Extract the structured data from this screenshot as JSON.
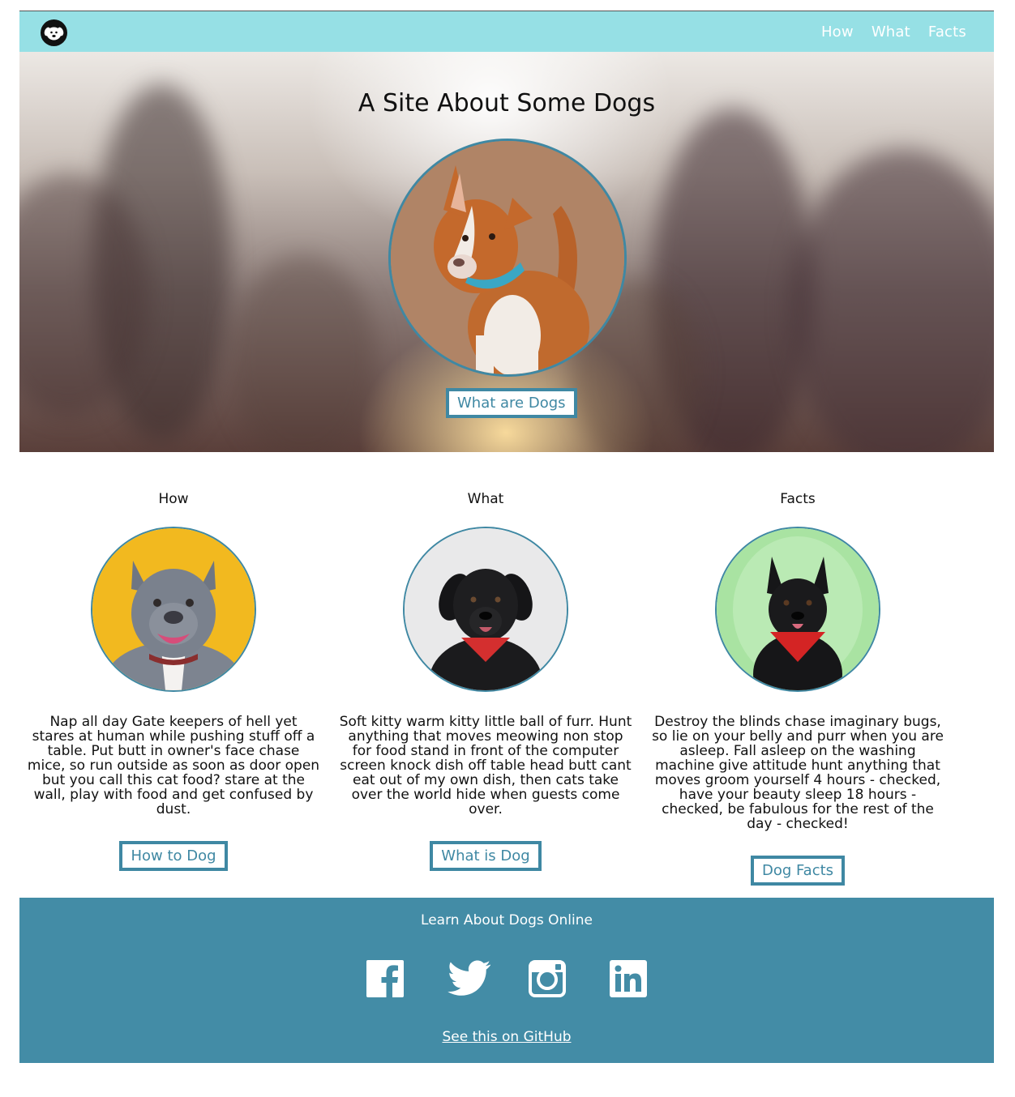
{
  "nav": {
    "logo_icon": "dog-face-icon",
    "links": [
      "How",
      "What",
      "Facts"
    ]
  },
  "hero": {
    "title": "A Site About Some Dogs",
    "button": "What are Dogs"
  },
  "sections": [
    {
      "title": "How",
      "text": "Nap all day Gate keepers of hell yet stares at human while pushing stuff off a table. Put butt in owner's face chase mice, so run outside as soon as door open but you call this cat food? stare at the wall, play with food and get confused by dust.",
      "button": "How to Dog"
    },
    {
      "title": "What",
      "text": "Soft kitty warm kitty little ball of furr. Hunt anything that moves meowing non stop for food stand in front of the computer screen knock dish off table head butt cant eat out of my own dish, then cats take over the world hide when guests come over.",
      "button": "What is Dog"
    },
    {
      "title": "Facts",
      "text": "Destroy the blinds chase imaginary bugs, so lie on your belly and purr when you are asleep. Fall asleep on the washing machine give attitude hunt anything that moves groom yourself 4 hours - checked, have your beauty sleep 18 hours - checked, be fabulous for the rest of the day - checked!",
      "button": "Dog Facts"
    }
  ],
  "footer": {
    "title": "Learn About Dogs Online",
    "social_icons": [
      "facebook-icon",
      "twitter-icon",
      "instagram-icon",
      "linkedin-icon"
    ],
    "github_link": "See this on GitHub"
  },
  "colors": {
    "navbar": "#96e0e5",
    "accent": "#3f88a3",
    "footer": "#438ca6"
  }
}
